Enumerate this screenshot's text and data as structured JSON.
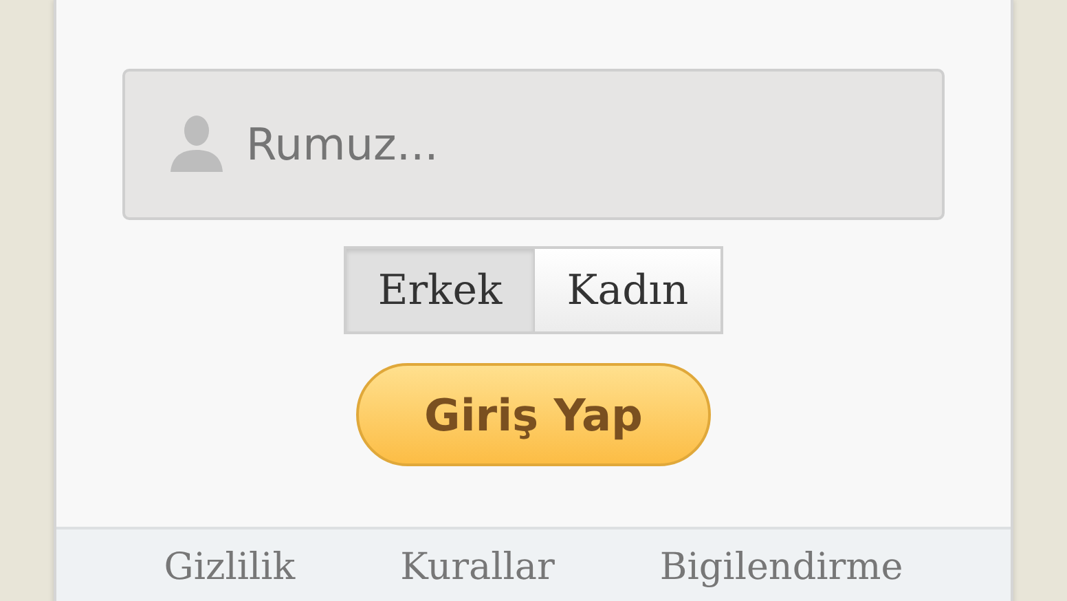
{
  "nickname_field": {
    "placeholder": "Rumuz..."
  },
  "gender": [
    {
      "label": "Erkek",
      "selected": true
    },
    {
      "label": "Kadın",
      "selected": false
    }
  ],
  "login_button": "Giriş Yap",
  "footer_links": [
    "Gizlilik",
    "Kurallar",
    "Bigilendirme"
  ]
}
